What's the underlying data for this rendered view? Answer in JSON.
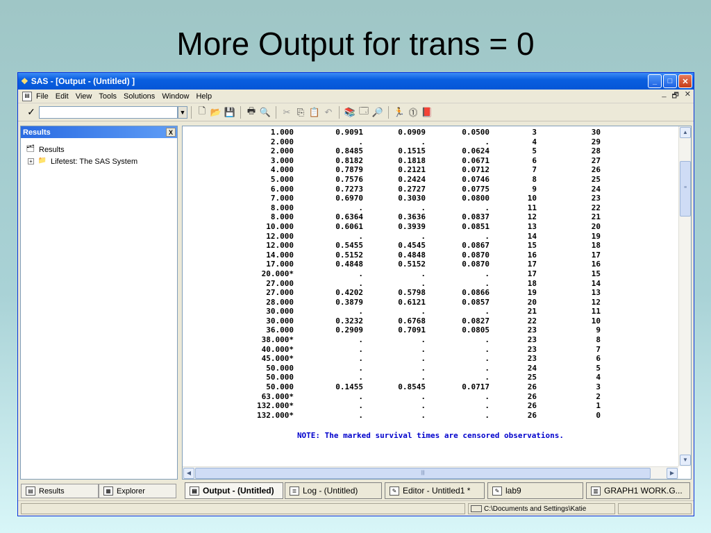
{
  "slide": {
    "title": "More Output for trans = 0"
  },
  "window": {
    "title": "SAS - [Output - (Untitled) ]",
    "controls": {
      "minimize": "_",
      "maximize": "□",
      "close": "✕"
    }
  },
  "menu": {
    "items": [
      "File",
      "Edit",
      "View",
      "Tools",
      "Solutions",
      "Window",
      "Help"
    ],
    "right_controls": [
      "_",
      "🗗",
      "✕"
    ]
  },
  "toolbar": {
    "command_value": "",
    "check": "✓",
    "dropdown": "▼"
  },
  "results_panel": {
    "header": "Results",
    "close": "X",
    "tree": [
      {
        "label": "Results"
      },
      {
        "label": "Lifetest:  The SAS System",
        "expander": "+"
      }
    ]
  },
  "output": {
    "rows": [
      [
        "1.000",
        "0.9091",
        "0.0909",
        "0.0500",
        "3",
        "30"
      ],
      [
        "2.000",
        ".",
        ".",
        ".",
        "4",
        "29"
      ],
      [
        "2.000",
        "0.8485",
        "0.1515",
        "0.0624",
        "5",
        "28"
      ],
      [
        "3.000",
        "0.8182",
        "0.1818",
        "0.0671",
        "6",
        "27"
      ],
      [
        "4.000",
        "0.7879",
        "0.2121",
        "0.0712",
        "7",
        "26"
      ],
      [
        "5.000",
        "0.7576",
        "0.2424",
        "0.0746",
        "8",
        "25"
      ],
      [
        "6.000",
        "0.7273",
        "0.2727",
        "0.0775",
        "9",
        "24"
      ],
      [
        "7.000",
        "0.6970",
        "0.3030",
        "0.0800",
        "10",
        "23"
      ],
      [
        "8.000",
        ".",
        ".",
        ".",
        "11",
        "22"
      ],
      [
        "8.000",
        "0.6364",
        "0.3636",
        "0.0837",
        "12",
        "21"
      ],
      [
        "10.000",
        "0.6061",
        "0.3939",
        "0.0851",
        "13",
        "20"
      ],
      [
        "12.000",
        ".",
        ".",
        ".",
        "14",
        "19"
      ],
      [
        "12.000",
        "0.5455",
        "0.4545",
        "0.0867",
        "15",
        "18"
      ],
      [
        "14.000",
        "0.5152",
        "0.4848",
        "0.0870",
        "16",
        "17"
      ],
      [
        "17.000",
        "0.4848",
        "0.5152",
        "0.0870",
        "17",
        "16"
      ],
      [
        "20.000*",
        ".",
        ".",
        ".",
        "17",
        "15"
      ],
      [
        "27.000",
        ".",
        ".",
        ".",
        "18",
        "14"
      ],
      [
        "27.000",
        "0.4202",
        "0.5798",
        "0.0866",
        "19",
        "13"
      ],
      [
        "28.000",
        "0.3879",
        "0.6121",
        "0.0857",
        "20",
        "12"
      ],
      [
        "30.000",
        ".",
        ".",
        ".",
        "21",
        "11"
      ],
      [
        "30.000",
        "0.3232",
        "0.6768",
        "0.0827",
        "22",
        "10"
      ],
      [
        "36.000",
        "0.2909",
        "0.7091",
        "0.0805",
        "23",
        "9"
      ],
      [
        "38.000*",
        ".",
        ".",
        ".",
        "23",
        "8"
      ],
      [
        "40.000*",
        ".",
        ".",
        ".",
        "23",
        "7"
      ],
      [
        "45.000*",
        ".",
        ".",
        ".",
        "23",
        "6"
      ],
      [
        "50.000",
        ".",
        ".",
        ".",
        "24",
        "5"
      ],
      [
        "50.000",
        ".",
        ".",
        ".",
        "25",
        "4"
      ],
      [
        "50.000",
        "0.1455",
        "0.8545",
        "0.0717",
        "26",
        "3"
      ],
      [
        "63.000*",
        ".",
        ".",
        ".",
        "26",
        "2"
      ],
      [
        "132.000*",
        ".",
        ".",
        ".",
        "26",
        "1"
      ],
      [
        "132.000*",
        ".",
        ".",
        ".",
        "26",
        "0"
      ]
    ],
    "note": "NOTE: The marked survival times are censored observations."
  },
  "panel_tabs": {
    "results": "Results",
    "explorer": "Explorer"
  },
  "window_tabs": [
    {
      "label": "Output - (Untitled)",
      "active": true
    },
    {
      "label": "Log - (Untitled)",
      "active": false
    },
    {
      "label": "Editor - Untitled1 *",
      "active": false
    },
    {
      "label": "lab9",
      "active": false
    },
    {
      "label": "GRAPH1   WORK.G...",
      "active": false
    }
  ],
  "statusbar": {
    "path": "C:\\Documents and Settings\\Katie"
  },
  "colors": {
    "title_bar": "#0556d6",
    "note_text": "#0000cc",
    "panel_header": "#2a6be2"
  }
}
